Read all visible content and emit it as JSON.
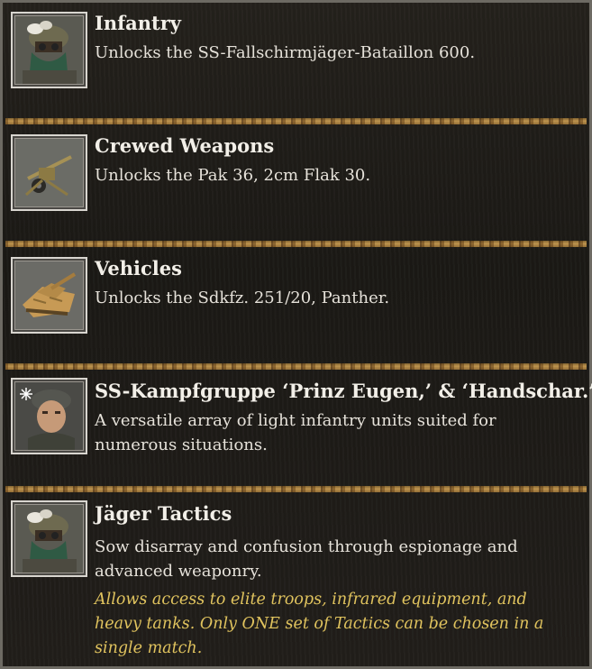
{
  "entries": [
    {
      "title": "Infantry",
      "description": "Unlocks the SS-Fallschirmjäger-Bataillon 600.",
      "icon": "camo-soldier-icon"
    },
    {
      "title": "Crewed Weapons",
      "description": "Unlocks the Pak 36, 2cm Flak 30.",
      "icon": "anti-tank-gun-icon"
    },
    {
      "title": "Vehicles",
      "description": "Unlocks the Sdkfz. 251/20, Panther.",
      "icon": "tank-icon"
    },
    {
      "title": "SS-Kampfgruppe ‘Prinz Eugen,’ & ‘Handschar.’",
      "description": "A versatile array of light infantry units suited for numerous situations.",
      "icon": "snowflake-soldier-icon"
    },
    {
      "title": "Jäger Tactics",
      "description": "Sow disarray and confusion through espionage and advanced weaponry.",
      "note": "Allows access to elite troops, infrared equipment, and heavy tanks. Only ONE set of Tactics can be chosen in a single match.",
      "icon": "camo-soldier-icon"
    }
  ],
  "colors": {
    "title": "#f2efe8",
    "text": "#e6e2da",
    "note": "#e0c35e",
    "separator": "#c79a52"
  }
}
